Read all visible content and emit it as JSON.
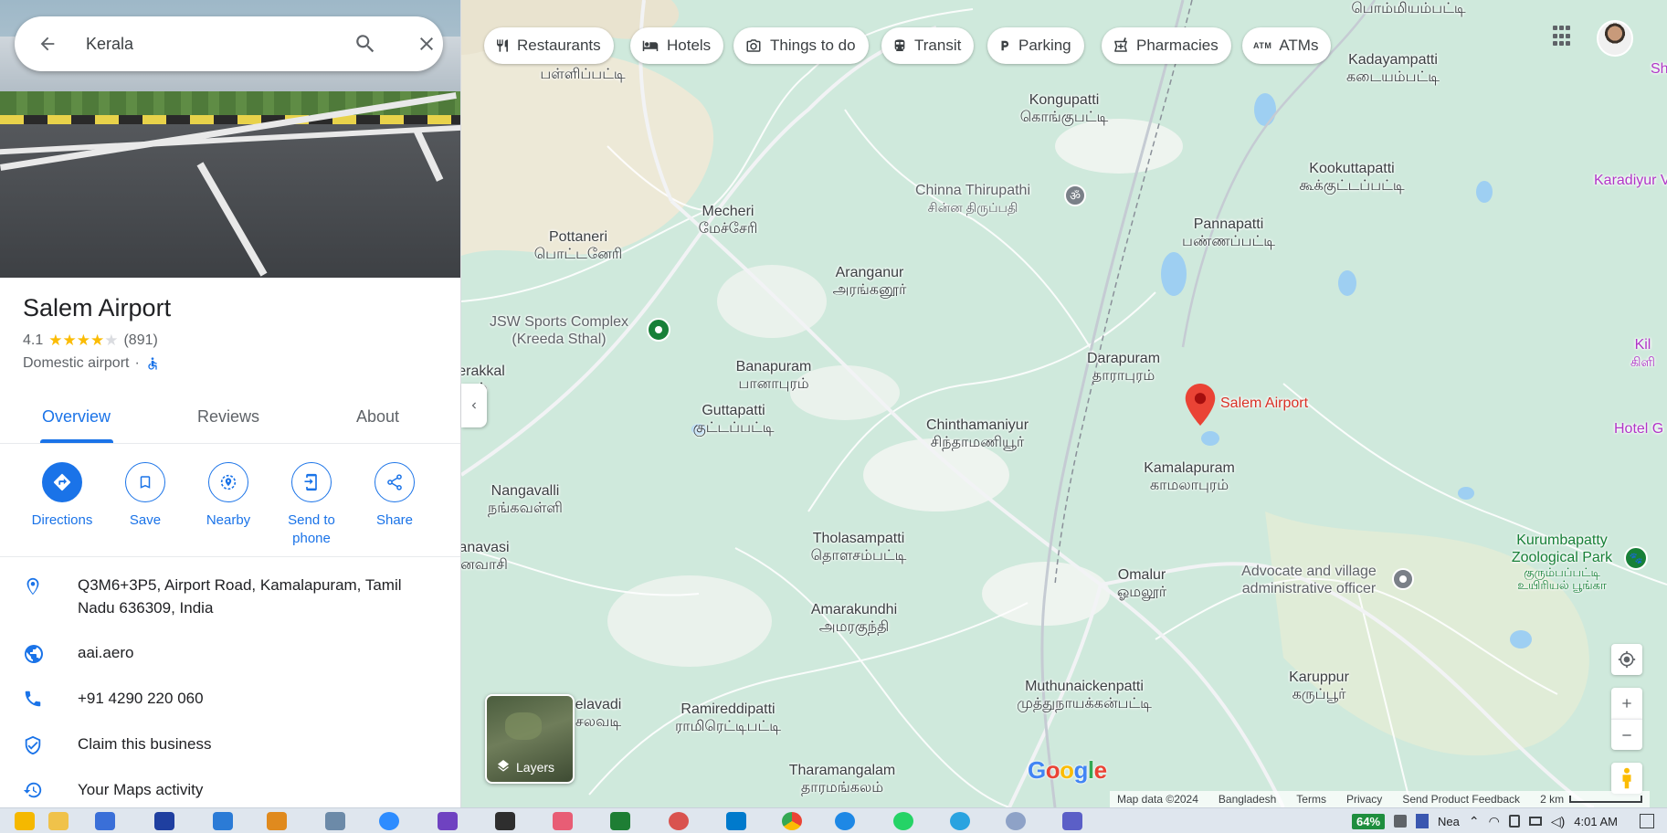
{
  "search": {
    "value": "Kerala"
  },
  "place": {
    "name": "Salem Airport",
    "rating": "4.1",
    "stars": 4.1,
    "reviews": "(891)",
    "category": "Domestic airport",
    "separator": "·"
  },
  "tabs": [
    {
      "label": "Overview"
    },
    {
      "label": "Reviews"
    },
    {
      "label": "About"
    }
  ],
  "actions": [
    {
      "label": "Directions",
      "icon": "directions-icon"
    },
    {
      "label": "Save",
      "icon": "bookmark-icon"
    },
    {
      "label": "Nearby",
      "icon": "nearby-icon"
    },
    {
      "label": "Send to phone",
      "icon": "send-to-phone-icon"
    },
    {
      "label": "Share",
      "icon": "share-icon"
    }
  ],
  "details": {
    "address": "Q3M6+3P5, Airport Road, Kamalapuram, Tamil Nadu 636309, India",
    "website": "aai.aero",
    "phone": "+91 4290 220 060",
    "claim": "Claim this business",
    "activity": "Your Maps activity"
  },
  "chips": [
    {
      "label": "Restaurants",
      "icon": "fork-knife-icon"
    },
    {
      "label": "Hotels",
      "icon": "bed-icon"
    },
    {
      "label": "Things to do",
      "icon": "camera-icon"
    },
    {
      "label": "Transit",
      "icon": "train-icon"
    },
    {
      "label": "Parking",
      "icon": "parking-icon"
    },
    {
      "label": "Pharmacies",
      "icon": "pharmacy-icon"
    },
    {
      "label": "ATMs",
      "icon": "atm-icon"
    }
  ],
  "map_labels": {
    "pallipatti": "பள்ளிப்பட்டி",
    "pommampatti": "பொம்மியம்பட்டி",
    "kadayampatti": {
      "en": "Kadayampatti",
      "ta": "கடையம்பட்டி"
    },
    "kongupatti": {
      "en": "Kongupatti",
      "ta": "கொங்குபட்டி"
    },
    "kookuttapatti": {
      "en": "Kookuttapatti",
      "ta": "கூக்குட்டப்பட்டி"
    },
    "chinna": {
      "en": "Chinna Thirupathi",
      "ta": "சின்ன திருப்பதி"
    },
    "karadiyur": "Karadiyur View Po",
    "mecheri": {
      "en": "Mecheri",
      "ta": "மேச்சேரி"
    },
    "pottaneri": {
      "en": "Pottaneri",
      "ta": "பொட்டனேரி"
    },
    "pannapatti": {
      "en": "Pannapatti",
      "ta": "பண்ணப்பட்டி"
    },
    "aranganur": {
      "en": "Aranganur",
      "ta": "அரங்கனூர்"
    },
    "jsw": {
      "en": "JSW Sports Complex",
      "sub": "(Kreeda Sthal)"
    },
    "darapuram": {
      "en": "Darapuram",
      "ta": "தாராபுரம்"
    },
    "salem_airport": "Salem Airport",
    "banapuram": {
      "en": "Banapuram",
      "ta": "பானாபுரம்"
    },
    "erakkal": {
      "en": "erakkal",
      "ta": "ல்"
    },
    "guttapatti": {
      "en": "Guttapatti",
      "ta": "குட்டப்பட்டி"
    },
    "chinthamaniyur": {
      "en": "Chinthamaniyur",
      "ta": "சிந்தாமணியூர்"
    },
    "kamalapuram": {
      "en": "Kamalapuram",
      "ta": "காமலாபுரம்"
    },
    "hotel": "Hotel G",
    "kil": {
      "en": "Kil",
      "ta": "கிளி"
    },
    "nangavalli": {
      "en": "Nangavalli",
      "ta": "நங்கவள்ளி"
    },
    "tholasampatti": {
      "en": "Tholasampatti",
      "ta": "தொளசம்பட்டி"
    },
    "kurumbapatty": {
      "en": "Kurumbapatty",
      "en2": "Zoological Park",
      "ta": "குரும்பப்பட்டி",
      "ta2": "உயிரியல் பூங்கா"
    },
    "anavasi": {
      "en": "anavasi",
      "ta": "னவாசி"
    },
    "omalur": {
      "en": "Omalur",
      "ta": "ஓமலூர்"
    },
    "advocate": {
      "en": "Advocate and village",
      "en2": "administrative officer"
    },
    "amarakundhi": {
      "en": "Amarakundhi",
      "ta": "அமரகுந்தி"
    },
    "muthunaicken": {
      "en": "Muthunaickenpatti",
      "ta": "முத்துநாயக்கன்பட்டி"
    },
    "karuppur": {
      "en": "Karuppur",
      "ta": "கருப்பூர்"
    },
    "elavadi": {
      "en": "elavadi",
      "ta": "சலவடி"
    },
    "ramireddipatti": {
      "en": "Ramireddipatti",
      "ta": "ராமிரெட்டிபட்டி"
    },
    "tharamangalam": {
      "en": "Tharamangalam",
      "ta": "தாரமங்கலம்"
    },
    "sh": "Sh"
  },
  "layers_label": "Layers",
  "google_logo": [
    "G",
    "o",
    "o",
    "g",
    "l",
    "e"
  ],
  "google_colors": [
    "#4285F4",
    "#EA4335",
    "#FBBC05",
    "#4285F4",
    "#34A853",
    "#EA4335"
  ],
  "attribution": {
    "data": "Map data ©2024",
    "region": "Bangladesh",
    "terms": "Terms",
    "privacy": "Privacy",
    "feedback": "Send Product Feedback",
    "scale": "2 km"
  },
  "taskbar": {
    "battery": "64%",
    "lang": "Nea",
    "time": "4:01 AM"
  },
  "colors": {
    "accent": "#1a73e8",
    "map_bg": "#cfe9dc",
    "pin": "#ea4335",
    "poi_green": "#188038"
  }
}
